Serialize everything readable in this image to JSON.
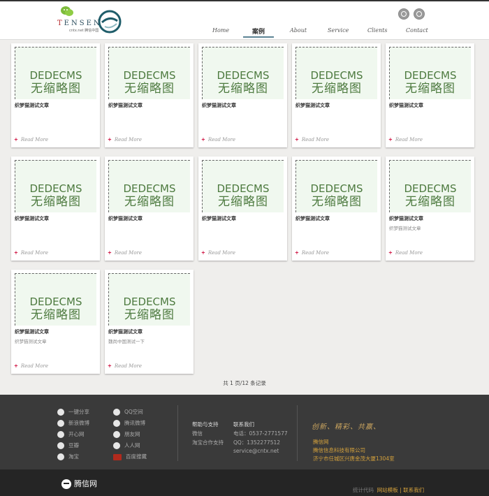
{
  "brand": {
    "logo_text_red": "T",
    "logo_text_rest": "ENSEN",
    "logo_sub": "cntx.net 腾信中国"
  },
  "nav": {
    "items": [
      "Home",
      "案例",
      "About",
      "Service",
      "Clients",
      "Contact"
    ]
  },
  "cards": [
    {
      "img_line1": "DEDECMS",
      "img_line2": "无缩略图",
      "title": "织梦猫测试文章",
      "desc": "",
      "read_more": "Read More"
    },
    {
      "img_line1": "DEDECMS",
      "img_line2": "无缩略图",
      "title": "织梦猫测试文章",
      "desc": "",
      "read_more": "Read More"
    },
    {
      "img_line1": "DEDECMS",
      "img_line2": "无缩略图",
      "title": "织梦猫测试文章",
      "desc": "",
      "read_more": "Read More"
    },
    {
      "img_line1": "DEDECMS",
      "img_line2": "无缩略图",
      "title": "织梦猫测试文章",
      "desc": "",
      "read_more": "Read More"
    },
    {
      "img_line1": "DEDECMS",
      "img_line2": "无缩略图",
      "title": "织梦猫测试文章",
      "desc": "",
      "read_more": "Read More"
    },
    {
      "img_line1": "DEDECMS",
      "img_line2": "无缩略图",
      "title": "织梦猫测试文章",
      "desc": "",
      "read_more": "Read More"
    },
    {
      "img_line1": "DEDECMS",
      "img_line2": "无缩略图",
      "title": "织梦猫测试文章",
      "desc": "",
      "read_more": "Read More"
    },
    {
      "img_line1": "DEDECMS",
      "img_line2": "无缩略图",
      "title": "织梦猫测试文章",
      "desc": "",
      "read_more": "Read More"
    },
    {
      "img_line1": "DEDECMS",
      "img_line2": "无缩略图",
      "title": "织梦猫测试文章",
      "desc": "",
      "read_more": "Read More"
    },
    {
      "img_line1": "DEDECMS",
      "img_line2": "无缩略图",
      "title": "织梦猫测试文章",
      "desc": "织梦猫测试文章",
      "read_more": "Read More"
    },
    {
      "img_line1": "DEDECMS",
      "img_line2": "无缩略图",
      "title": "织梦猫测试文章",
      "desc": "织梦猫测试文章",
      "read_more": "Read More"
    },
    {
      "img_line1": "DEDECMS",
      "img_line2": "无缩略图",
      "title": "织梦猫测试文章",
      "desc": "魏尚中国测试一下",
      "read_more": "Read More"
    }
  ],
  "pagination": "共 1 页/12 条记录",
  "footer": {
    "share_col1": [
      "一键分享",
      "新浪微博",
      "开心网",
      "豆瓣",
      "淘宝"
    ],
    "share_col2": [
      "QQ空间",
      "腾讯微博",
      "朋友网",
      "人人网",
      "百度搜藏"
    ],
    "help_title": "帮助与支持",
    "help_items": [
      "微信",
      "淘宝合作支持"
    ],
    "contact_title": "联系我们",
    "contact_items": [
      "电话：0537-2771577",
      "QQ：1352277512",
      "service@cntx.net"
    ],
    "slogan": "创新、精彩、共赢、",
    "company_lines": [
      "腾信网",
      "腾信信息科技有限公司",
      "济宁市任城区兴唐金茂大厦1304室"
    ]
  },
  "bottom": {
    "logo_text": "腾信网",
    "link_stats": "统计代码",
    "link_template": "网站模板",
    "separator": "|",
    "link_contact": "联系我们"
  },
  "colors": {
    "accent": "#5c8495",
    "footer_bg": "#3a3a3a",
    "gold": "#d4a13c",
    "thumb_text": "#4d7a3f"
  }
}
